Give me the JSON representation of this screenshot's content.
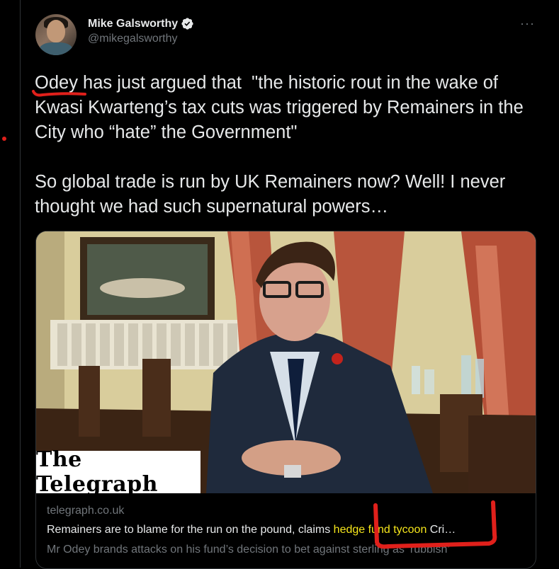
{
  "author": {
    "name": "Mike Galsworthy",
    "handle": "@mikegalsworthy",
    "verified_icon": "verified-badge-icon"
  },
  "menu": {
    "more_label": "···"
  },
  "tweet": {
    "text": "Odey has just argued that  \"the historic rout in the wake of Kwasi Kwarteng’s tax cuts was triggered by Remainers in the City who “hate” the Government\"\n\nSo global trade is run by UK Remainers now? Well! I never thought we had such supernatural powers…"
  },
  "card": {
    "brand": "The Telegraph",
    "domain": "telegraph.co.uk",
    "headline_before": "Remainers are to blame for the run on the pound, claims",
    "headline_highlight": "hedge fund tycoon",
    "headline_after": "Cri…",
    "description": "Mr Odey brands attacks on his fund’s decision to bet against sterling as ‘rubbish’"
  },
  "colors": {
    "background": "#000000",
    "primary_text": "#e7e9ea",
    "secondary_text": "#71767b",
    "highlight": "#f6e61b",
    "annotation_red": "#e0201b"
  }
}
